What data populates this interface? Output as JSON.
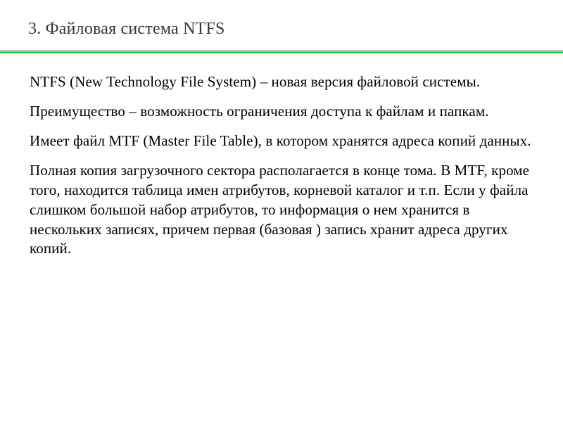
{
  "slide": {
    "title": "3. Файловая система NTFS",
    "paragraphs": [
      "NTFS (New Technology File System) – новая версия файловой системы.",
      "Преимущество – возможность ограничения доступа к файлам и папкам.",
      "Имеет файл MTF (Master File Table), в котором хранятся адреса копий данных.",
      "Полная копия загрузочного сектора располагается в конце тома. В MTF, кроме того, находится таблица имен атрибутов, корневой каталог и т.п. Если у файла слишком большой набор атрибутов, то информация о нем хранится в нескольких записях, причем первая (базовая ) запись хранит адреса других копий."
    ]
  },
  "colors": {
    "accent": "#2ecc40",
    "text": "#000000",
    "title": "#383838"
  }
}
